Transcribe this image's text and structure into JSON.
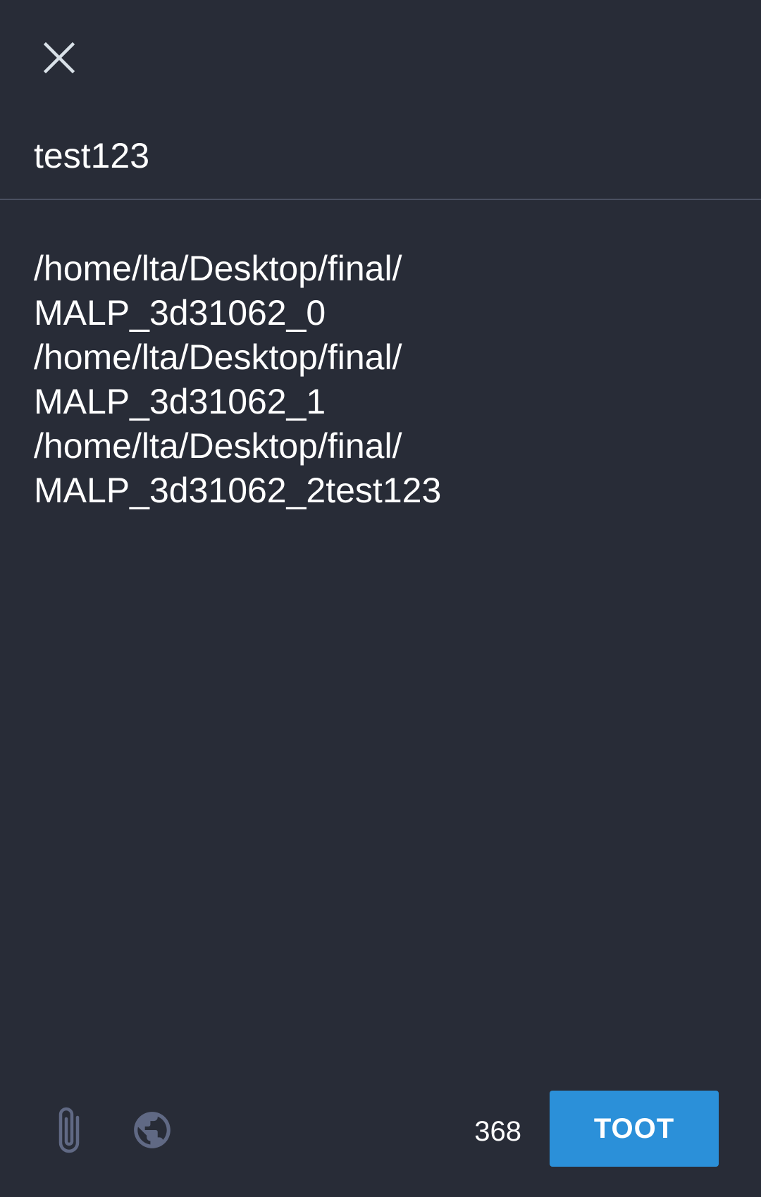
{
  "header": {
    "close_icon": "close-icon"
  },
  "content_warning": {
    "value": "test123"
  },
  "compose": {
    "text": "/home/lta/Desktop/final/\nMALP_3d31062_0\n/home/lta/Desktop/final/\nMALP_3d31062_1\n/home/lta/Desktop/final/\nMALP_3d31062_2test123"
  },
  "toolbar": {
    "attach_icon": "paperclip-icon",
    "visibility_icon": "globe-icon",
    "char_count": "368",
    "toot_label": "TOOT"
  },
  "colors": {
    "background": "#282c37",
    "accent": "#2b90d9",
    "icon": "#606984"
  }
}
